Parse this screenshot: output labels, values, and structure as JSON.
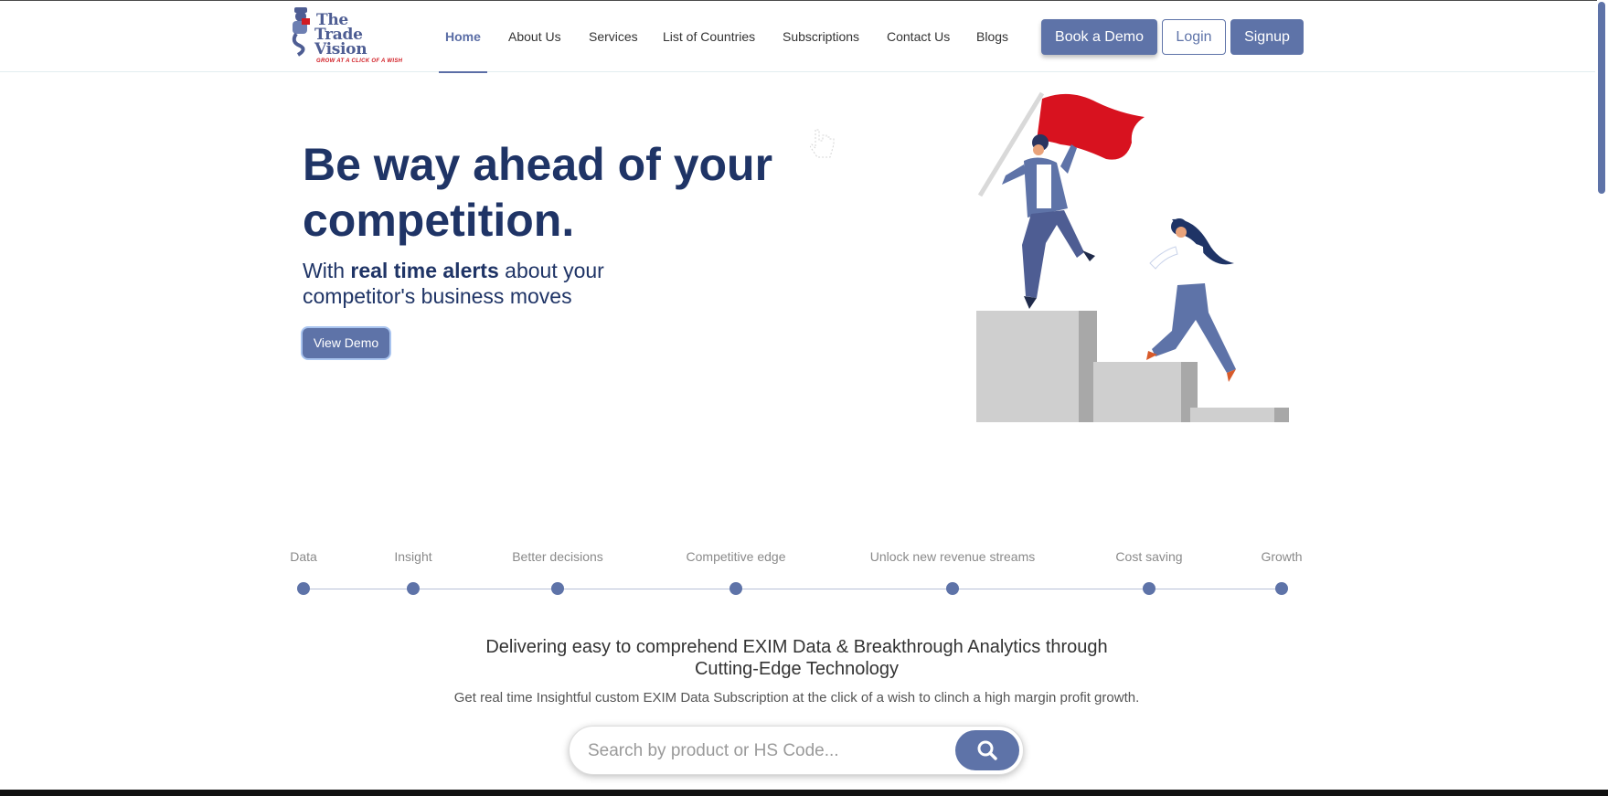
{
  "brand": {
    "line1": "The",
    "line2": "Trade",
    "line3": "Vision",
    "tagline": "GROW AT A CLICK OF A WISH"
  },
  "nav": {
    "items": [
      {
        "label": "Home",
        "active": true
      },
      {
        "label": "About Us"
      },
      {
        "label": "Services"
      },
      {
        "label": "List of Countries"
      },
      {
        "label": "Subscriptions"
      },
      {
        "label": "Contact Us"
      },
      {
        "label": "Blogs"
      }
    ],
    "book_demo": "Book a Demo",
    "login": "Login",
    "signup": "Signup"
  },
  "hero": {
    "title_line1": "Be way ahead of your",
    "title_line2": "competition.",
    "sub_prefix": "With ",
    "sub_bold": "real time alerts",
    "sub_suffix": " about your competitor's business moves",
    "cta": "View Demo"
  },
  "timeline": {
    "steps": [
      "Data",
      "Insight",
      "Better decisions",
      "Competitive edge",
      "Unlock new revenue streams",
      "Cost saving",
      "Growth"
    ]
  },
  "intro": {
    "heading_line1": "Delivering easy to comprehend EXIM Data & Breakthrough Analytics through",
    "heading_line2": "Cutting-Edge Technology",
    "subtext": "Get real time Insightful custom EXIM Data Subscription at the click of a wish to clinch a high margin profit growth."
  },
  "search": {
    "placeholder": "Search by product or HS Code...",
    "value": ""
  },
  "colors": {
    "primary": "#5e73a8",
    "heading": "#1f3466",
    "flag": "#d8121f",
    "brand_red": "#d11b22"
  },
  "icons": {
    "search": "search-icon",
    "logo": "genie-mascot-logo"
  }
}
